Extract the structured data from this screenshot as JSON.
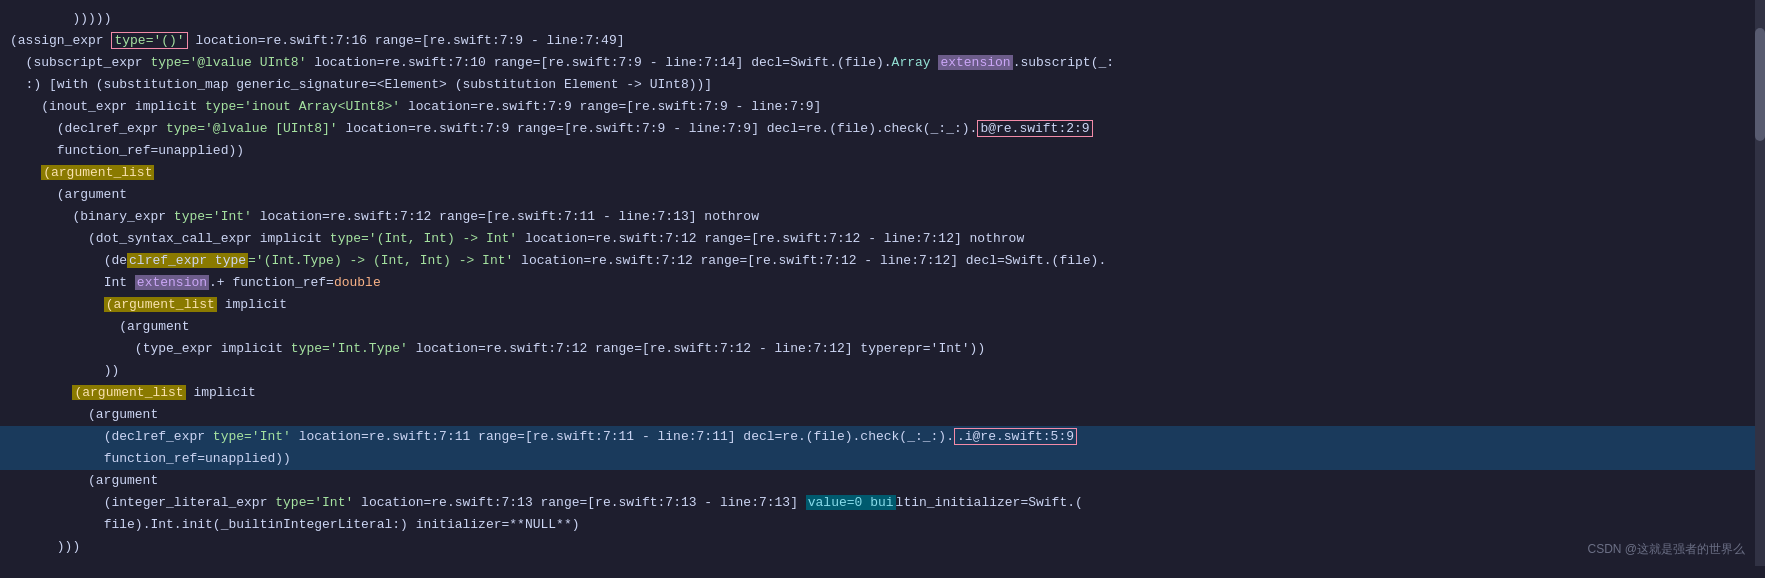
{
  "lines": [
    {
      "id": 1,
      "indent": "        ",
      "highlight": false,
      "parts": [
        {
          "text": ")))))",
          "class": "c-paren"
        }
      ]
    },
    {
      "id": 2,
      "indent": "",
      "highlight": false,
      "parts": [
        {
          "text": "(assign_expr ",
          "class": "c-white"
        },
        {
          "text": "type='()'",
          "class": "c-string",
          "box": "red"
        },
        {
          "text": " location=re.swift:7:16 range=[re.swift:7:9 - line:7:49]",
          "class": "c-white"
        }
      ]
    },
    {
      "id": 3,
      "indent": "  ",
      "highlight": false,
      "parts": [
        {
          "text": "(subscript_expr ",
          "class": "c-white"
        },
        {
          "text": "type='@lvalue UInt8'",
          "class": "c-string"
        },
        {
          "text": " location=re.swift:7:10 range=[re.swift:7:9 - line:7:14] decl=Swift.(file).",
          "class": "c-white"
        },
        {
          "text": "Array",
          "class": "c-teal"
        },
        {
          "text": " ",
          "class": "c-white"
        },
        {
          "text": "extension",
          "class": "c-purple",
          "box": "purple"
        },
        {
          "text": ".subscript(_:",
          "class": "c-white"
        }
      ]
    },
    {
      "id": 4,
      "indent": "  ",
      "highlight": false,
      "parts": [
        {
          "text": ":) [with (substitution_map generic_signature=<Element> (substitution Element -> UInt8))]",
          "class": "c-white"
        }
      ]
    },
    {
      "id": 5,
      "indent": "    ",
      "highlight": false,
      "parts": [
        {
          "text": "(inout_expr implicit ",
          "class": "c-white"
        },
        {
          "text": "type='inout Array<UInt8>'",
          "class": "c-string"
        },
        {
          "text": " location=re.swift:7:9 range=[re.swift:7:9 - line:7:9]",
          "class": "c-white"
        }
      ]
    },
    {
      "id": 6,
      "indent": "      ",
      "highlight": false,
      "parts": [
        {
          "text": "(declref_expr ",
          "class": "c-white"
        },
        {
          "text": "type='@lvalue [UInt8]'",
          "class": "c-string"
        },
        {
          "text": " location=re.swift:7:9 range=[re.swift:7:9 - line:7:9] decl=re.(file).check(_:_:).",
          "class": "c-white"
        },
        {
          "text": "b@re.swift:2:9",
          "class": "c-white",
          "box": "red"
        }
      ]
    },
    {
      "id": 7,
      "indent": "      ",
      "highlight": false,
      "parts": [
        {
          "text": "function_ref=unapplied))",
          "class": "c-white"
        }
      ]
    },
    {
      "id": 8,
      "indent": "    ",
      "highlight": false,
      "parts": [
        {
          "text": "(argument_list",
          "class": "c-yellow",
          "box": "yellow-bg"
        }
      ]
    },
    {
      "id": 9,
      "indent": "      ",
      "highlight": false,
      "parts": [
        {
          "text": "(argument",
          "class": "c-white"
        }
      ]
    },
    {
      "id": 10,
      "indent": "        ",
      "highlight": false,
      "parts": [
        {
          "text": "(binary_expr ",
          "class": "c-white"
        },
        {
          "text": "type='Int'",
          "class": "c-string"
        },
        {
          "text": " location=re.swift:7:12 range=[re.swift:7:11 - line:7:13] nothrow",
          "class": "c-white"
        }
      ]
    },
    {
      "id": 11,
      "indent": "          ",
      "highlight": false,
      "parts": [
        {
          "text": "(dot_syntax_call_expr implicit ",
          "class": "c-white"
        },
        {
          "text": "type='(Int, Int) -> Int'",
          "class": "c-string"
        },
        {
          "text": " location=re.swift:7:12 range=[re.swift:7:12 - line:7:12] nothrow",
          "class": "c-white"
        }
      ]
    },
    {
      "id": 12,
      "indent": "            ",
      "highlight": true,
      "parts": [
        {
          "text": "(de",
          "class": "c-white"
        },
        {
          "text": "clref_expr type",
          "class": "c-white",
          "box": "yellow-bg2"
        },
        {
          "text": "='(Int.Type) -> (Int, Int) -> Int' ",
          "class": "c-string"
        },
        {
          "text": "location=re.swift:7:12 range=[re.swift:7:12 - line:7:12] decl=Swift.(file).",
          "class": "c-white"
        }
      ]
    },
    {
      "id": 13,
      "indent": "            ",
      "highlight": true,
      "parts": [
        {
          "text": "Int ",
          "class": "c-white"
        },
        {
          "text": "extension",
          "class": "c-purple",
          "box": "purple"
        },
        {
          "text": ".+ function_ref=",
          "class": "c-white"
        },
        {
          "text": "double",
          "class": "c-orange"
        }
      ]
    },
    {
      "id": 14,
      "indent": "            ",
      "highlight": false,
      "parts": [
        {
          "text": "(argument_list",
          "class": "c-yellow",
          "box": "yellow-bg"
        },
        {
          "text": " implicit",
          "class": "c-white"
        }
      ]
    },
    {
      "id": 15,
      "indent": "              ",
      "highlight": false,
      "parts": [
        {
          "text": "(argument",
          "class": "c-white"
        }
      ]
    },
    {
      "id": 16,
      "indent": "                ",
      "highlight": false,
      "parts": [
        {
          "text": "(type_expr implicit ",
          "class": "c-white"
        },
        {
          "text": "type='Int.Type'",
          "class": "c-string"
        },
        {
          "text": " location=re.swift:7:12 range=[re.swift:7:12 - line:7:12] typerepr='Int'))",
          "class": "c-white"
        }
      ]
    },
    {
      "id": 17,
      "indent": "            ",
      "highlight": false,
      "parts": [
        {
          "text": "))",
          "class": "c-white"
        }
      ]
    },
    {
      "id": 18,
      "indent": "        ",
      "highlight": false,
      "parts": [
        {
          "text": "(argument_list",
          "class": "c-yellow",
          "box": "yellow-bg"
        },
        {
          "text": " implicit",
          "class": "c-white"
        }
      ]
    },
    {
      "id": 19,
      "indent": "          ",
      "highlight": false,
      "parts": [
        {
          "text": "(argument",
          "class": "c-white"
        }
      ]
    },
    {
      "id": 20,
      "indent": "            ",
      "highlight": true,
      "lineBg": "line-highlight-blue",
      "parts": [
        {
          "text": "(declref_expr ",
          "class": "c-white"
        },
        {
          "text": "type='Int'",
          "class": "c-string"
        },
        {
          "text": " location=re.swift:7:11 range=[re.swift:7:11 - line:7:11] decl=re.(file).check(_:_:).",
          "class": "c-white"
        },
        {
          "text": ".i@re.swift:5:9",
          "class": "c-white",
          "box": "red"
        }
      ]
    },
    {
      "id": 21,
      "indent": "            ",
      "highlight": true,
      "lineBg": "line-highlight-blue",
      "parts": [
        {
          "text": "function_ref=unapplied))",
          "class": "c-white"
        }
      ]
    },
    {
      "id": 22,
      "indent": "          ",
      "highlight": false,
      "parts": [
        {
          "text": "(argument",
          "class": "c-white"
        }
      ]
    },
    {
      "id": 23,
      "indent": "            ",
      "highlight": false,
      "parts": [
        {
          "text": "(integer_literal_expr ",
          "class": "c-white"
        },
        {
          "text": "type='Int'",
          "class": "c-string"
        },
        {
          "text": " location=re.swift:7:13 range=[re.swift:7:13 - line:7:13] ",
          "class": "c-white"
        },
        {
          "text": "value=0 bui",
          "class": "c-cyan",
          "box": "cyan-bg"
        },
        {
          "text": "ltin_initializer=Swift.(",
          "class": "c-white"
        }
      ]
    },
    {
      "id": 24,
      "indent": "            ",
      "highlight": false,
      "parts": [
        {
          "text": "file).Int.init(_builtinIntegerLiteral:) initializer=**NULL**)",
          "class": "c-white"
        }
      ]
    },
    {
      "id": 25,
      "indent": "      ",
      "highlight": false,
      "parts": [
        {
          "text": ")))",
          "class": "c-white"
        }
      ]
    }
  ],
  "watermark": "CSDN @这就是强者的世界么"
}
